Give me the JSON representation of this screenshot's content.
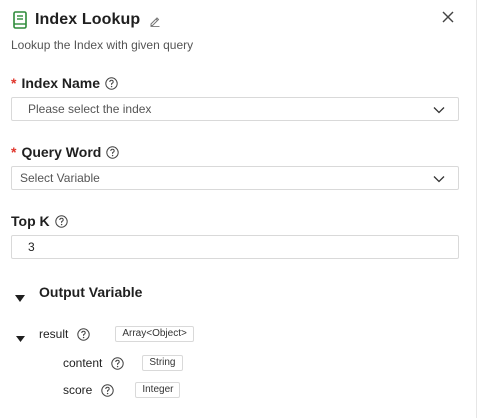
{
  "header": {
    "title": "Index Lookup",
    "icon": "book-icon",
    "edit_icon": "edit-icon",
    "close_icon": "close-icon",
    "accent_color": "#2e8b3a"
  },
  "description": "Lookup the Index with given query",
  "fields": {
    "index_name": {
      "label": "Index Name",
      "required": "*",
      "placeholder": "Please select the index"
    },
    "query_word": {
      "label": "Query Word",
      "required": "*",
      "value": "Select Variable"
    },
    "top_k": {
      "label": "Top K",
      "value": "3"
    }
  },
  "output": {
    "section_label": "Output Variable",
    "variables": [
      {
        "name": "result",
        "type": "Array<Object>"
      },
      {
        "name": "content",
        "type": "String"
      },
      {
        "name": "score",
        "type": "Integer"
      }
    ]
  },
  "colors": {
    "required": "#e0362c",
    "border": "#d9d9d9"
  }
}
